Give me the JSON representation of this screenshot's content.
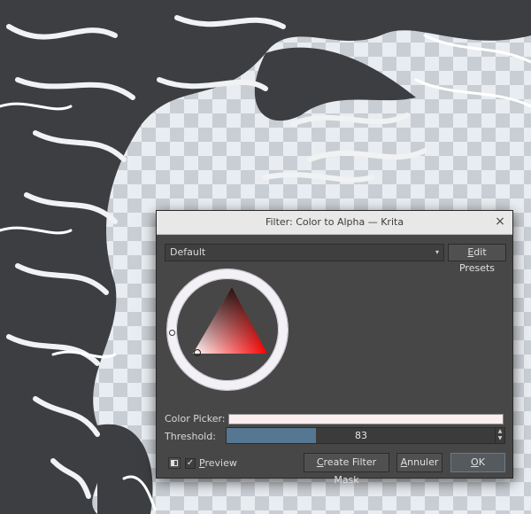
{
  "dialog": {
    "title": "Filter: Color to Alpha — Krita",
    "close_glyph": "×",
    "preset": {
      "selected": "Default",
      "arrow_glyph": "▾"
    },
    "edit_presets": {
      "mnemonic": "E",
      "rest": "dit Presets"
    },
    "color_picker": {
      "label": "Color Picker:",
      "color": "#fbeeee"
    },
    "threshold": {
      "label": "Threshold:",
      "value": "83",
      "fraction": 0.323,
      "fill_color": "#557791",
      "spin_up": "▲",
      "spin_down": "▼"
    },
    "preview": {
      "checked_glyph": "✓",
      "mnemonic": "P",
      "rest": "review"
    },
    "buttons": {
      "create_mask": {
        "mnemonic": "C",
        "rest": "reate Filter Mask"
      },
      "cancel": {
        "mnemonic": "A",
        "rest": "nnuler"
      },
      "ok": {
        "mnemonic": "O",
        "rest": "K"
      }
    },
    "triangle_hue": "#ff0000"
  }
}
